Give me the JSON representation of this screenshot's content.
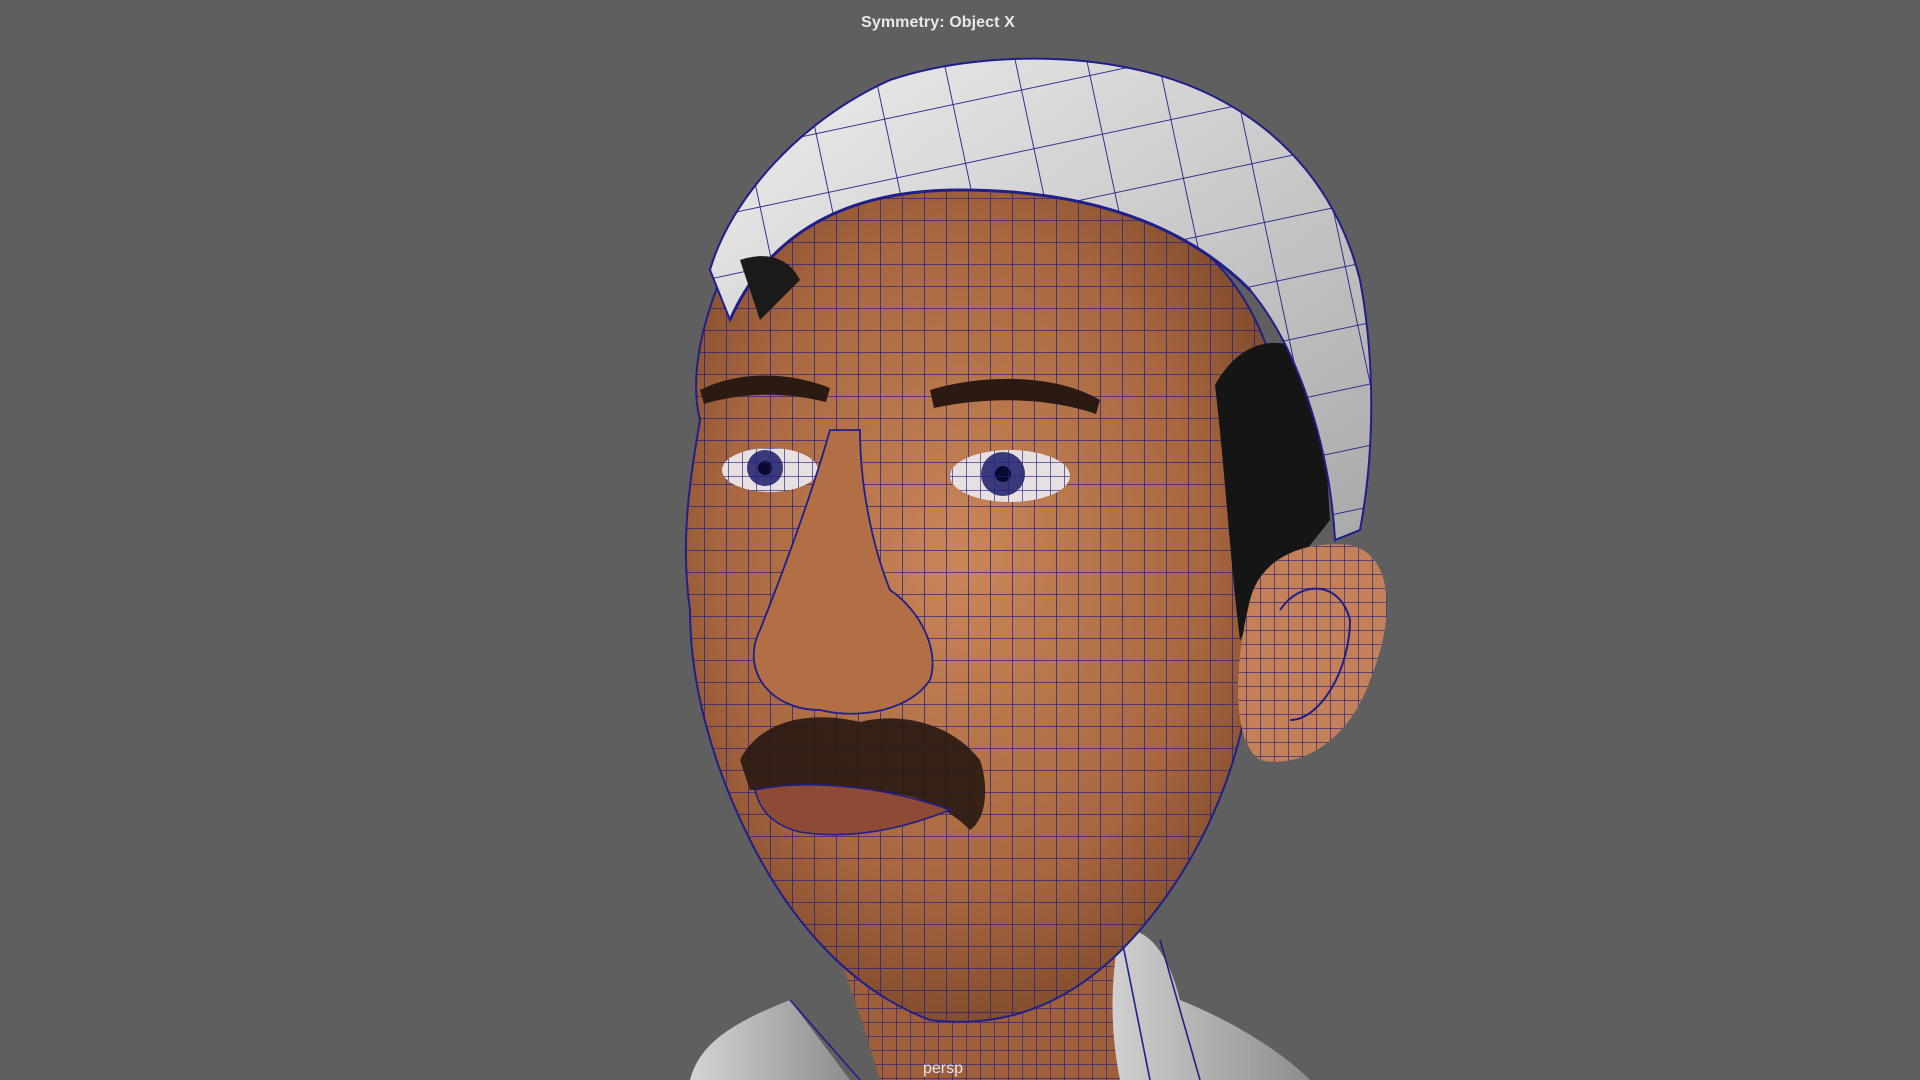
{
  "viewport": {
    "symmetry_label": "Symmetry: Object X",
    "camera_label": "persp",
    "background_color": "#5f5f5f",
    "wire_color": "#1a1a7a",
    "skin_color": "#b8734a",
    "cap_color": "#d8d8d8",
    "shirt_color": "#c8c8c8"
  },
  "model": {
    "subject": "head-mesh",
    "display_mode": "wireframe-on-shaded"
  }
}
